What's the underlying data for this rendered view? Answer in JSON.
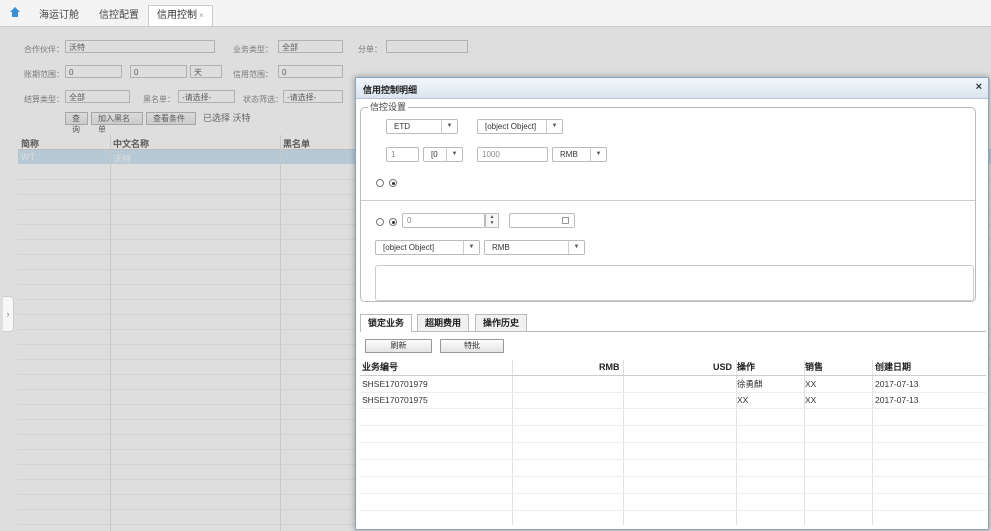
{
  "tabs": [
    "海运订舱",
    "信控配置",
    "信用控制"
  ],
  "filters": {
    "row1": [
      {
        "label": "合作伙伴：",
        "value": "沃特"
      },
      {
        "label": "业务类型：",
        "value": "全部"
      },
      {
        "label": "分单：",
        "value": ""
      }
    ],
    "row2": [
      {
        "label": "账期范围：",
        "value1": "0",
        "value2": "0",
        "unit": "天"
      },
      {
        "label": "信用范围：",
        "value1": "0",
        "value2": "0",
        "currency": "RMB"
      }
    ],
    "row3": [
      {
        "label": "结算类型：",
        "value": "全部"
      },
      {
        "label": "黑名单：",
        "value": "-请选择-"
      },
      {
        "label": "状态筛选：",
        "value": "-请选择-"
      }
    ],
    "buttons": [
      "查询",
      "加入黑名单",
      "查看条件"
    ],
    "selected_text": "已选择 沃特"
  },
  "grid": {
    "headers": [
      "简称",
      "中文名称",
      "黑名单"
    ],
    "rows": [
      {
        "short": "WT",
        "cn": "沃特",
        "black": ""
      }
    ]
  },
  "modal": {
    "title": "信用控制明细",
    "close": "×",
    "legend": "信控设置",
    "sel_etd": "ETD",
    "sel_obj1": "[object Object]",
    "input_1": "1",
    "sel_0": "[0",
    "input_1000": "1000",
    "sel_rmb1": "RMB",
    "num_0": "0",
    "sel_obj2": "[object Object]",
    "sel_rmb2": "RMB",
    "tabs": [
      "锁定业务",
      "超期费用",
      "操作历史"
    ],
    "buttons": [
      "刷新",
      "特批"
    ],
    "table": {
      "headers": [
        "业务编号",
        "RMB",
        "USD",
        "操作",
        "销售",
        "创建日期"
      ],
      "rows": [
        {
          "id": "SHSE170701979",
          "rmb": "",
          "usd": "",
          "op": "徐勇麒",
          "sales": "XX",
          "date": "2017-07-13"
        },
        {
          "id": "SHSE170701975",
          "rmb": "",
          "usd": "",
          "op": "XX",
          "sales": "XX",
          "date": "2017-07-13"
        }
      ]
    }
  }
}
